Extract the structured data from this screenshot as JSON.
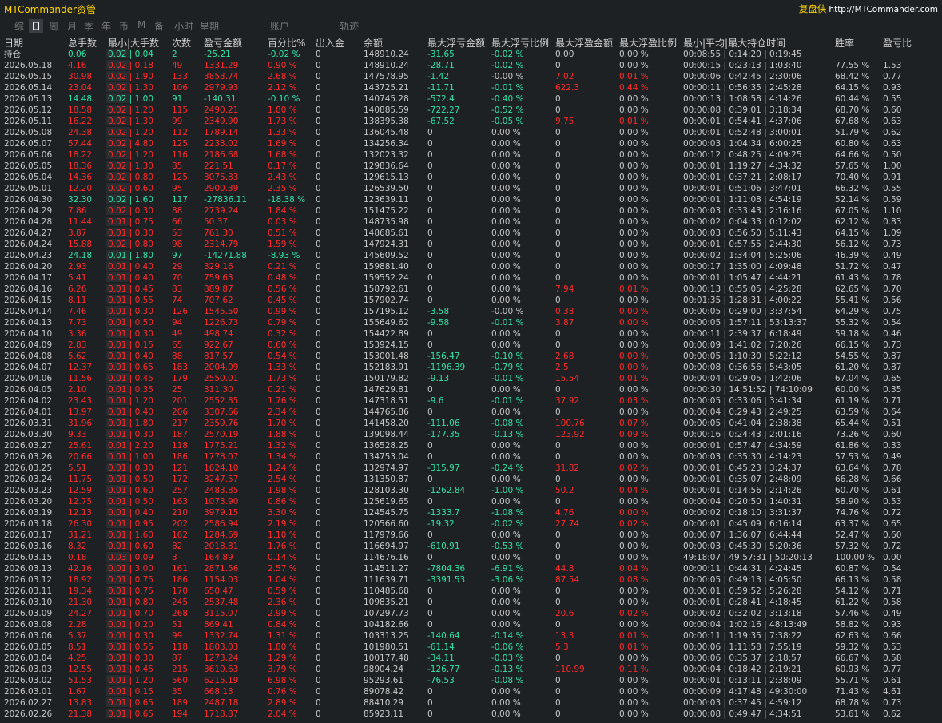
{
  "app_title": "MTCommander资管",
  "brand": {
    "name": "复盘侠",
    "url": "http://MTCommander.com"
  },
  "tabs": [
    {
      "label": "综"
    },
    {
      "label": "日",
      "active": true
    },
    {
      "label": "周"
    },
    {
      "label": "月"
    },
    {
      "label": "季"
    },
    {
      "label": "年"
    },
    {
      "label": "币"
    },
    {
      "label": "M"
    },
    {
      "label": "备"
    },
    {
      "label": "小时"
    },
    {
      "label": "星期"
    },
    {
      "label": "账户"
    },
    {
      "label": "轨迹"
    }
  ],
  "headers": [
    "日期",
    "总手数",
    "最小|大手数",
    "次数",
    "盈亏金额",
    "百分比%",
    "出入金",
    "余额",
    "最大浮亏金额",
    "最大浮亏比例",
    "最大浮盈金额",
    "最大浮盈比例",
    "最小|平均|最大持仓时间",
    "胜率",
    "盈亏比"
  ],
  "colors": {
    "positive": "#ff2a2a",
    "negative": "#2ee3a5",
    "neutral": "#c8c8c8",
    "title": "#ffd700"
  },
  "rows": [
    [
      "持仓",
      "0.06",
      "0.02 | 0.04",
      "2",
      "-25.21",
      "-0.02 %",
      "0",
      "148910.24",
      "-31.65",
      "-0.02 %",
      "0.00",
      "0.00 %",
      "00:08:55 | 0:14:20 | 0:19:45",
      "",
      ""
    ],
    [
      "2026.05.18",
      "4.16",
      "0.02 | 0.18",
      "49",
      "1331.29",
      "0.90 %",
      "0",
      "148910.24",
      "-28.71",
      "-0.02 %",
      "0",
      "0.00 %",
      "00:00:15 | 0:23:13 | 1:03:40",
      "77.55 %",
      "1.53"
    ],
    [
      "2026.05.15",
      "30.98",
      "0.02 | 1.90",
      "133",
      "3853.74",
      "2.68 %",
      "0",
      "147578.95",
      "-1.42",
      "-0.00 %",
      "7.02",
      "0.01 %",
      "00:00:06 | 0:42:45 | 2:30:06",
      "68.42 %",
      "0.77"
    ],
    [
      "2026.05.14",
      "23.04",
      "0.02 | 1.30",
      "106",
      "2979.93",
      "2.12 %",
      "0",
      "143725.21",
      "-11.71",
      "-0.01 %",
      "622.3",
      "0.44 %",
      "00:00:11 | 0:56:35 | 2:45:28",
      "64.15 %",
      "0.93"
    ],
    [
      "2026.05.13",
      "14.48",
      "0.02 | 1.00",
      "91",
      "-140.31",
      "-0.10 %",
      "0",
      "140745.28",
      "-572.4",
      "-0.40 %",
      "0",
      "0.00 %",
      "00:00:13 | 1:08:58 | 4:14:26",
      "60.44 %",
      "0.55"
    ],
    [
      "2026.05.12",
      "18.58",
      "0.02 | 1.20",
      "115",
      "2490.21",
      "1.80 %",
      "0",
      "140885.59",
      "-722.27",
      "-0.52 %",
      "0",
      "0.00 %",
      "00:00:08 | 0:39:01 | 3:18:34",
      "68.70 %",
      "0.60"
    ],
    [
      "2026.05.11",
      "16.22",
      "0.02 | 1.30",
      "99",
      "2349.90",
      "1.73 %",
      "0",
      "138395.38",
      "-67.52",
      "-0.05 %",
      "9.75",
      "0.01 %",
      "00:00:01 | 0:54:41 | 4:37:06",
      "67.68 %",
      "0.63"
    ],
    [
      "2026.05.08",
      "24.38",
      "0.02 | 1.20",
      "112",
      "1789.14",
      "1.33 %",
      "0",
      "136045.48",
      "0",
      "0.00 %",
      "0",
      "0.00 %",
      "00:00:01 | 0:52:48 | 3:00:01",
      "51.79 %",
      "0.62"
    ],
    [
      "2026.05.07",
      "57.44",
      "0.02 | 4.80",
      "125",
      "2233.02",
      "1.69 %",
      "0",
      "134256.34",
      "0",
      "0.00 %",
      "0",
      "0.00 %",
      "00:00:03 | 1:04:34 | 6:00:25",
      "60.80 %",
      "0.63"
    ],
    [
      "2026.05.06",
      "18.22",
      "0.02 | 1.20",
      "116",
      "2186.68",
      "1.68 %",
      "0",
      "132023.32",
      "0",
      "0.00 %",
      "0",
      "0.00 %",
      "00:00:12 | 0:48:25 | 4:09:25",
      "64.66 %",
      "0.50"
    ],
    [
      "2026.05.05",
      "18.36",
      "0.02 | 1.30",
      "85",
      "221.51",
      "0.17 %",
      "0",
      "129836.64",
      "0",
      "0.00 %",
      "0",
      "0.00 %",
      "00:00:01 | 1:19:27 | 4:34:32",
      "57.65 %",
      "1.00"
    ],
    [
      "2026.05.04",
      "14.36",
      "0.02 | 0.80",
      "125",
      "3075.83",
      "2.43 %",
      "0",
      "129615.13",
      "0",
      "0.00 %",
      "0",
      "0.00 %",
      "00:00:01 | 0:37:21 | 2:08:17",
      "70.40 %",
      "0.91"
    ],
    [
      "2026.05.01",
      "12.20",
      "0.02 | 0.60",
      "95",
      "2900.39",
      "2.35 %",
      "0",
      "126539.50",
      "0",
      "0.00 %",
      "0",
      "0.00 %",
      "00:00:01 | 0:51:06 | 3:47:01",
      "66.32 %",
      "0.55"
    ],
    [
      "2026.04.30",
      "32.30",
      "0.02 | 1.60",
      "117",
      "-27836.11",
      "-18.38 %",
      "0",
      "123639.11",
      "0",
      "0.00 %",
      "0",
      "0.00 %",
      "00:00:01 | 1:11:08 | 4:54:19",
      "52.14 %",
      "0.59"
    ],
    [
      "2026.04.29",
      "7.86",
      "0.02 | 0.30",
      "88",
      "2739.24",
      "1.84 %",
      "0",
      "151475.22",
      "0",
      "0.00 %",
      "0",
      "0.00 %",
      "00:00:03 | 0:33:43 | 2:16:16",
      "67.05 %",
      "1.10"
    ],
    [
      "2026.04.28",
      "11.44",
      "0.01 | 0.75",
      "66",
      "50.37",
      "0.03 %",
      "0",
      "148735.98",
      "0",
      "0.00 %",
      "0",
      "0.00 %",
      "00:00:02 | 0:04:33 | 0:12:02",
      "62.12 %",
      "0.83"
    ],
    [
      "2026.04.27",
      "3.87",
      "0.01 | 0.30",
      "53",
      "761.30",
      "0.51 %",
      "0",
      "148685.61",
      "0",
      "0.00 %",
      "0",
      "0.00 %",
      "00:00:03 | 0:56:50 | 5:11:43",
      "64.15 %",
      "1.09"
    ],
    [
      "2026.04.24",
      "15.88",
      "0.02 | 0.80",
      "98",
      "2314.79",
      "1.59 %",
      "0",
      "147924.31",
      "0",
      "0.00 %",
      "0",
      "0.00 %",
      "00:00:01 | 0:57:55 | 2:44:30",
      "56.12 %",
      "0.73"
    ],
    [
      "2026.04.23",
      "24.18",
      "0.01 | 1.80",
      "97",
      "-14271.88",
      "-8.93 %",
      "0",
      "145609.52",
      "0",
      "0.00 %",
      "0",
      "0.00 %",
      "00:00:02 | 1:34:04 | 5:25:06",
      "46.39 %",
      "0.49"
    ],
    [
      "2026.04.20",
      "2.93",
      "0.01 | 0.40",
      "29",
      "329.16",
      "0.21 %",
      "0",
      "159881.40",
      "0",
      "0.00 %",
      "0",
      "0.00 %",
      "00:00:17 | 1:35:00 | 4:09:48",
      "51.72 %",
      "0.47"
    ],
    [
      "2026.04.17",
      "5.41",
      "0.01 | 0.40",
      "70",
      "759.63",
      "0.48 %",
      "0",
      "159552.24",
      "0",
      "0.00 %",
      "0",
      "0.00 %",
      "00:00:01 | 1:05:47 | 4:44:21",
      "61.43 %",
      "0.78"
    ],
    [
      "2026.04.16",
      "6.26",
      "0.01 | 0.45",
      "83",
      "889.87",
      "0.56 %",
      "0",
      "158792.61",
      "0",
      "0.00 %",
      "7.94",
      "0.01 %",
      "00:00:13 | 0:55:05 | 4:25:28",
      "62.65 %",
      "0.70"
    ],
    [
      "2026.04.15",
      "8.11",
      "0.01 | 0.55",
      "74",
      "707.62",
      "0.45 %",
      "0",
      "157902.74",
      "0",
      "0.00 %",
      "0",
      "0.00 %",
      "00:01:35 | 1:28:31 | 4:00:22",
      "55.41 %",
      "0.56"
    ],
    [
      "2026.04.14",
      "7.46",
      "0.01 | 0.30",
      "126",
      "1545.50",
      "0.99 %",
      "0",
      "157195.12",
      "-3.58",
      "-0.00 %",
      "0.38",
      "0.00 %",
      "00:00:05 | 0:29:00 | 3:37:54",
      "64.29 %",
      "0.75"
    ],
    [
      "2026.04.13",
      "7.73",
      "0.01 | 0.50",
      "94",
      "1226.73",
      "0.79 %",
      "0",
      "155649.62",
      "-9.58",
      "-0.01 %",
      "3.87",
      "0.00 %",
      "00:00:05 | 1:57:11 | 53:13:37",
      "55.32 %",
      "0.54"
    ],
    [
      "2026.04.10",
      "3.36",
      "0.01 | 0.30",
      "49",
      "498.74",
      "0.32 %",
      "0",
      "154422.89",
      "0",
      "0.00 %",
      "0",
      "0.00 %",
      "00:00:11 | 2:39:37 | 6:18:49",
      "59.18 %",
      "0.46"
    ],
    [
      "2026.04.09",
      "2.83",
      "0.01 | 0.15",
      "65",
      "922.67",
      "0.60 %",
      "0",
      "153924.15",
      "0",
      "0.00 %",
      "0",
      "0.00 %",
      "00:00:09 | 1:41:02 | 7:20:26",
      "66.15 %",
      "0.73"
    ],
    [
      "2026.04.08",
      "5.62",
      "0.01 | 0.40",
      "88",
      "817.57",
      "0.54 %",
      "0",
      "153001.48",
      "-156.47",
      "-0.10 %",
      "2.68",
      "0.00 %",
      "00:00:05 | 1:10:30 | 5:22:12",
      "54.55 %",
      "0.87"
    ],
    [
      "2026.04.07",
      "12.37",
      "0.01 | 0.65",
      "183",
      "2004.09",
      "1.33 %",
      "0",
      "152183.91",
      "-1196.39",
      "-0.79 %",
      "2.5",
      "0.00 %",
      "00:00:08 | 0:36:56 | 5:43:05",
      "61.20 %",
      "0.87"
    ],
    [
      "2026.04.06",
      "11.56",
      "0.01 | 0.45",
      "179",
      "2550.01",
      "1.73 %",
      "0",
      "150179.82",
      "-9.13",
      "-0.01 %",
      "15.54",
      "0.01 %",
      "00:00:04 | 0:29:05 | 1:42:06",
      "67.04 %",
      "0.65"
    ],
    [
      "2026.04.05",
      "2.10",
      "0.01 | 0.35",
      "25",
      "311.30",
      "0.21 %",
      "0",
      "147629.81",
      "0",
      "0.00 %",
      "0",
      "0.00 %",
      "00:00:30 | 14:51:52 | 74:10:09",
      "60.00 %",
      "0.35"
    ],
    [
      "2026.04.02",
      "23.43",
      "0.01 | 1.20",
      "201",
      "2552.85",
      "1.76 %",
      "0",
      "147318.51",
      "-9.6",
      "-0.01 %",
      "37.92",
      "0.03 %",
      "00:00:05 | 0:33:06 | 3:41:34",
      "61.19 %",
      "0.71"
    ],
    [
      "2026.04.01",
      "13.97",
      "0.01 | 0.40",
      "206",
      "3307.66",
      "2.34 %",
      "0",
      "144765.86",
      "0",
      "0.00 %",
      "0",
      "0.00 %",
      "00:00:04 | 0:29:43 | 2:49:25",
      "63.59 %",
      "0.64"
    ],
    [
      "2026.03.31",
      "31.96",
      "0.01 | 1.80",
      "217",
      "2359.76",
      "1.70 %",
      "0",
      "141458.20",
      "-111.06",
      "-0.08 %",
      "100.76",
      "0.07 %",
      "00:00:05 | 0:41:04 | 2:38:38",
      "65.44 %",
      "0.51"
    ],
    [
      "2026.03.30",
      "9.33",
      "0.01 | 0.30",
      "187",
      "2570.19",
      "1.88 %",
      "0",
      "139098.44",
      "-177.35",
      "-0.13 %",
      "123.92",
      "0.09 %",
      "00:00:16 | 0:24:43 | 2:01:16",
      "73.26 %",
      "0.60"
    ],
    [
      "2026.03.27",
      "25.61",
      "0.01 | 2.20",
      "118",
      "1775.21",
      "1.32 %",
      "0",
      "136528.25",
      "0",
      "0.00 %",
      "0",
      "0.00 %",
      "00:00:01 | 0:57:47 | 4:34:59",
      "61.86 %",
      "0.33"
    ],
    [
      "2026.03.26",
      "20.66",
      "0.01 | 1.00",
      "186",
      "1778.07",
      "1.34 %",
      "0",
      "134753.04",
      "0",
      "0.00 %",
      "0",
      "0.00 %",
      "00:00:03 | 0:35:30 | 4:14:23",
      "57.53 %",
      "0.49"
    ],
    [
      "2026.03.25",
      "5.51",
      "0.01 | 0.30",
      "121",
      "1624.10",
      "1.24 %",
      "0",
      "132974.97",
      "-315.97",
      "-0.24 %",
      "31.82",
      "0.02 %",
      "00:00:01 | 0:45:23 | 3:24:37",
      "63.64 %",
      "0.78"
    ],
    [
      "2026.03.24",
      "11.75",
      "0.01 | 0.50",
      "172",
      "3247.57",
      "2.54 %",
      "0",
      "131350.87",
      "0",
      "0.00 %",
      "0",
      "0.00 %",
      "00:00:01 | 0:35:07 | 2:48:09",
      "66.28 %",
      "0.66"
    ],
    [
      "2026.03.23",
      "12.59",
      "0.01 | 0.60",
      "257",
      "2483.85",
      "1.98 %",
      "0",
      "128103.30",
      "-1262.84",
      "-1.00 %",
      "50.2",
      "0.04 %",
      "00:00:01 | 0:14:56 | 2:14:26",
      "60.70 %",
      "0.61"
    ],
    [
      "2026.03.20",
      "12.75",
      "0.01 | 0.50",
      "163",
      "1073.90",
      "0.86 %",
      "0",
      "125619.65",
      "0",
      "0.00 %",
      "0",
      "0.00 %",
      "00:00:04 | 0:20:50 | 1:40:31",
      "58.90 %",
      "0.53"
    ],
    [
      "2026.03.19",
      "12.13",
      "0.01 | 0.40",
      "210",
      "3979.15",
      "3.30 %",
      "0",
      "124545.75",
      "-1333.7",
      "-1.08 %",
      "4.76",
      "0.00 %",
      "00:00:02 | 0:18:10 | 3:31:37",
      "74.76 %",
      "0.72"
    ],
    [
      "2026.03.18",
      "26.30",
      "0.01 | 0.95",
      "202",
      "2586.94",
      "2.19 %",
      "0",
      "120566.60",
      "-19.32",
      "-0.02 %",
      "27.74",
      "0.02 %",
      "00:00:01 | 0:45:09 | 6:16:14",
      "63.37 %",
      "0.65"
    ],
    [
      "2026.03.17",
      "31.21",
      "0.01 | 1.60",
      "162",
      "1284.69",
      "1.10 %",
      "0",
      "117979.66",
      "0",
      "0.00 %",
      "0",
      "0.00 %",
      "00:00:07 | 1:36:07 | 6:44:44",
      "52.47 %",
      "0.60"
    ],
    [
      "2026.03.16",
      "8.32",
      "0.01 | 0.60",
      "82",
      "2018.81",
      "1.76 %",
      "0",
      "116694.97",
      "-610.91",
      "-0.53 %",
      "0",
      "0.00 %",
      "00:00:03 | 0:45:30 | 5:20:36",
      "57.32 %",
      "0.72"
    ],
    [
      "2026.03.15",
      "0.18",
      "0.03 | 0.09",
      "3",
      "164.89",
      "0.14 %",
      "0",
      "114676.16",
      "0",
      "0.00 %",
      "0",
      "0.00 %",
      "49:18:07 | 49:57:31 | 50:20:13",
      "100.00 %",
      "0.00"
    ],
    [
      "2026.03.13",
      "42.16",
      "0.01 | 3.00",
      "161",
      "2871.56",
      "2.57 %",
      "0",
      "114511.27",
      "-7804.36",
      "-6.91 %",
      "44.8",
      "0.04 %",
      "00:00:11 | 0:44:31 | 4:24:45",
      "60.87 %",
      "0.54"
    ],
    [
      "2026.03.12",
      "18.92",
      "0.01 | 0.75",
      "186",
      "1154.03",
      "1.04 %",
      "0",
      "111639.71",
      "-3391.53",
      "-3.06 %",
      "87.54",
      "0.08 %",
      "00:00:05 | 0:49:13 | 4:05:50",
      "66.13 %",
      "0.58"
    ],
    [
      "2026.03.11",
      "19.34",
      "0.01 | 0.75",
      "170",
      "650.47",
      "0.59 %",
      "0",
      "110485.68",
      "0",
      "0.00 %",
      "0",
      "0.00 %",
      "00:00:01 | 0:59:52 | 5:26:28",
      "54.12 %",
      "0.71"
    ],
    [
      "2026.03.10",
      "21.30",
      "0.01 | 0.80",
      "245",
      "2537.48",
      "2.36 %",
      "0",
      "109835.21",
      "0",
      "0.00 %",
      "0",
      "0.00 %",
      "00:00:01 | 0:28:41 | 4:18:45",
      "61.22 %",
      "0.58"
    ],
    [
      "2026.03.09",
      "24.27",
      "0.01 | 0.70",
      "268",
      "3115.07",
      "2.99 %",
      "0",
      "107297.73",
      "0",
      "0.00 %",
      "20.6",
      "0.02 %",
      "00:00:02 | 0:32:02 | 3:13:18",
      "57.46 %",
      "0.49"
    ],
    [
      "2026.03.08",
      "2.28",
      "0.01 | 0.20",
      "51",
      "869.41",
      "0.84 %",
      "0",
      "104182.66",
      "0",
      "0.00 %",
      "0",
      "0.00 %",
      "00:00:04 | 1:02:16 | 48:13:49",
      "58.82 %",
      "0.93"
    ],
    [
      "2026.03.06",
      "5.37",
      "0.01 | 0.30",
      "99",
      "1332.74",
      "1.31 %",
      "0",
      "103313.25",
      "-140.64",
      "-0.14 %",
      "13.3",
      "0.01 %",
      "00:00:11 | 1:19:35 | 7:38:22",
      "62.63 %",
      "0.66"
    ],
    [
      "2026.03.05",
      "8.51",
      "0.01 | 0.55",
      "118",
      "1803.03",
      "1.80 %",
      "0",
      "101980.51",
      "-61.14",
      "-0.06 %",
      "5.3",
      "0.01 %",
      "00:00:06 | 1:11:58 | 7:55:19",
      "59.32 %",
      "0.53"
    ],
    [
      "2026.03.04",
      "4.25",
      "0.01 | 0.30",
      "87",
      "1273.24",
      "1.29 %",
      "0",
      "100177.48",
      "-34.11",
      "-0.03 %",
      "0",
      "0.00 %",
      "00:00:06 | 0:35:37 | 2:18:57",
      "66.67 %",
      "0.58"
    ],
    [
      "2026.03.03",
      "12.55",
      "0.01 | 0.45",
      "215",
      "3610.63",
      "3.79 %",
      "0",
      "98904.24",
      "-126.77",
      "-0.13 %",
      "110.99",
      "0.11 %",
      "00:00:04 | 0:18:42 | 2:19:21",
      "60.93 %",
      "0.77"
    ],
    [
      "2026.03.02",
      "51.53",
      "0.01 | 1.20",
      "560",
      "6215.19",
      "6.98 %",
      "0",
      "95293.61",
      "-76.53",
      "-0.08 %",
      "0",
      "0.00 %",
      "00:00:01 | 0:13:11 | 2:38:09",
      "55.71 %",
      "0.61"
    ],
    [
      "2026.03.01",
      "1.67",
      "0.01 | 0.15",
      "35",
      "668.13",
      "0.76 %",
      "0",
      "89078.42",
      "0",
      "0.00 %",
      "0",
      "0.00 %",
      "00:00:09 | 4:17:48 | 49:30:00",
      "71.43 %",
      "4.61"
    ],
    [
      "2026.02.27",
      "13.83",
      "0.01 | 0.65",
      "189",
      "2487.18",
      "2.89 %",
      "0",
      "88410.29",
      "0",
      "0.00 %",
      "0",
      "0.00 %",
      "00:00:03 | 0:37:45 | 4:59:12",
      "68.78 %",
      "0.73"
    ],
    [
      "2026.02.26",
      "21.38",
      "0.01 | 0.65",
      "194",
      "1718.87",
      "2.04 %",
      "0",
      "85923.11",
      "0",
      "0.00 %",
      "0",
      "0.00 %",
      "00:00:08 | 0:49:47 | 4:34:51",
      "53.61 %",
      "0.62"
    ]
  ]
}
